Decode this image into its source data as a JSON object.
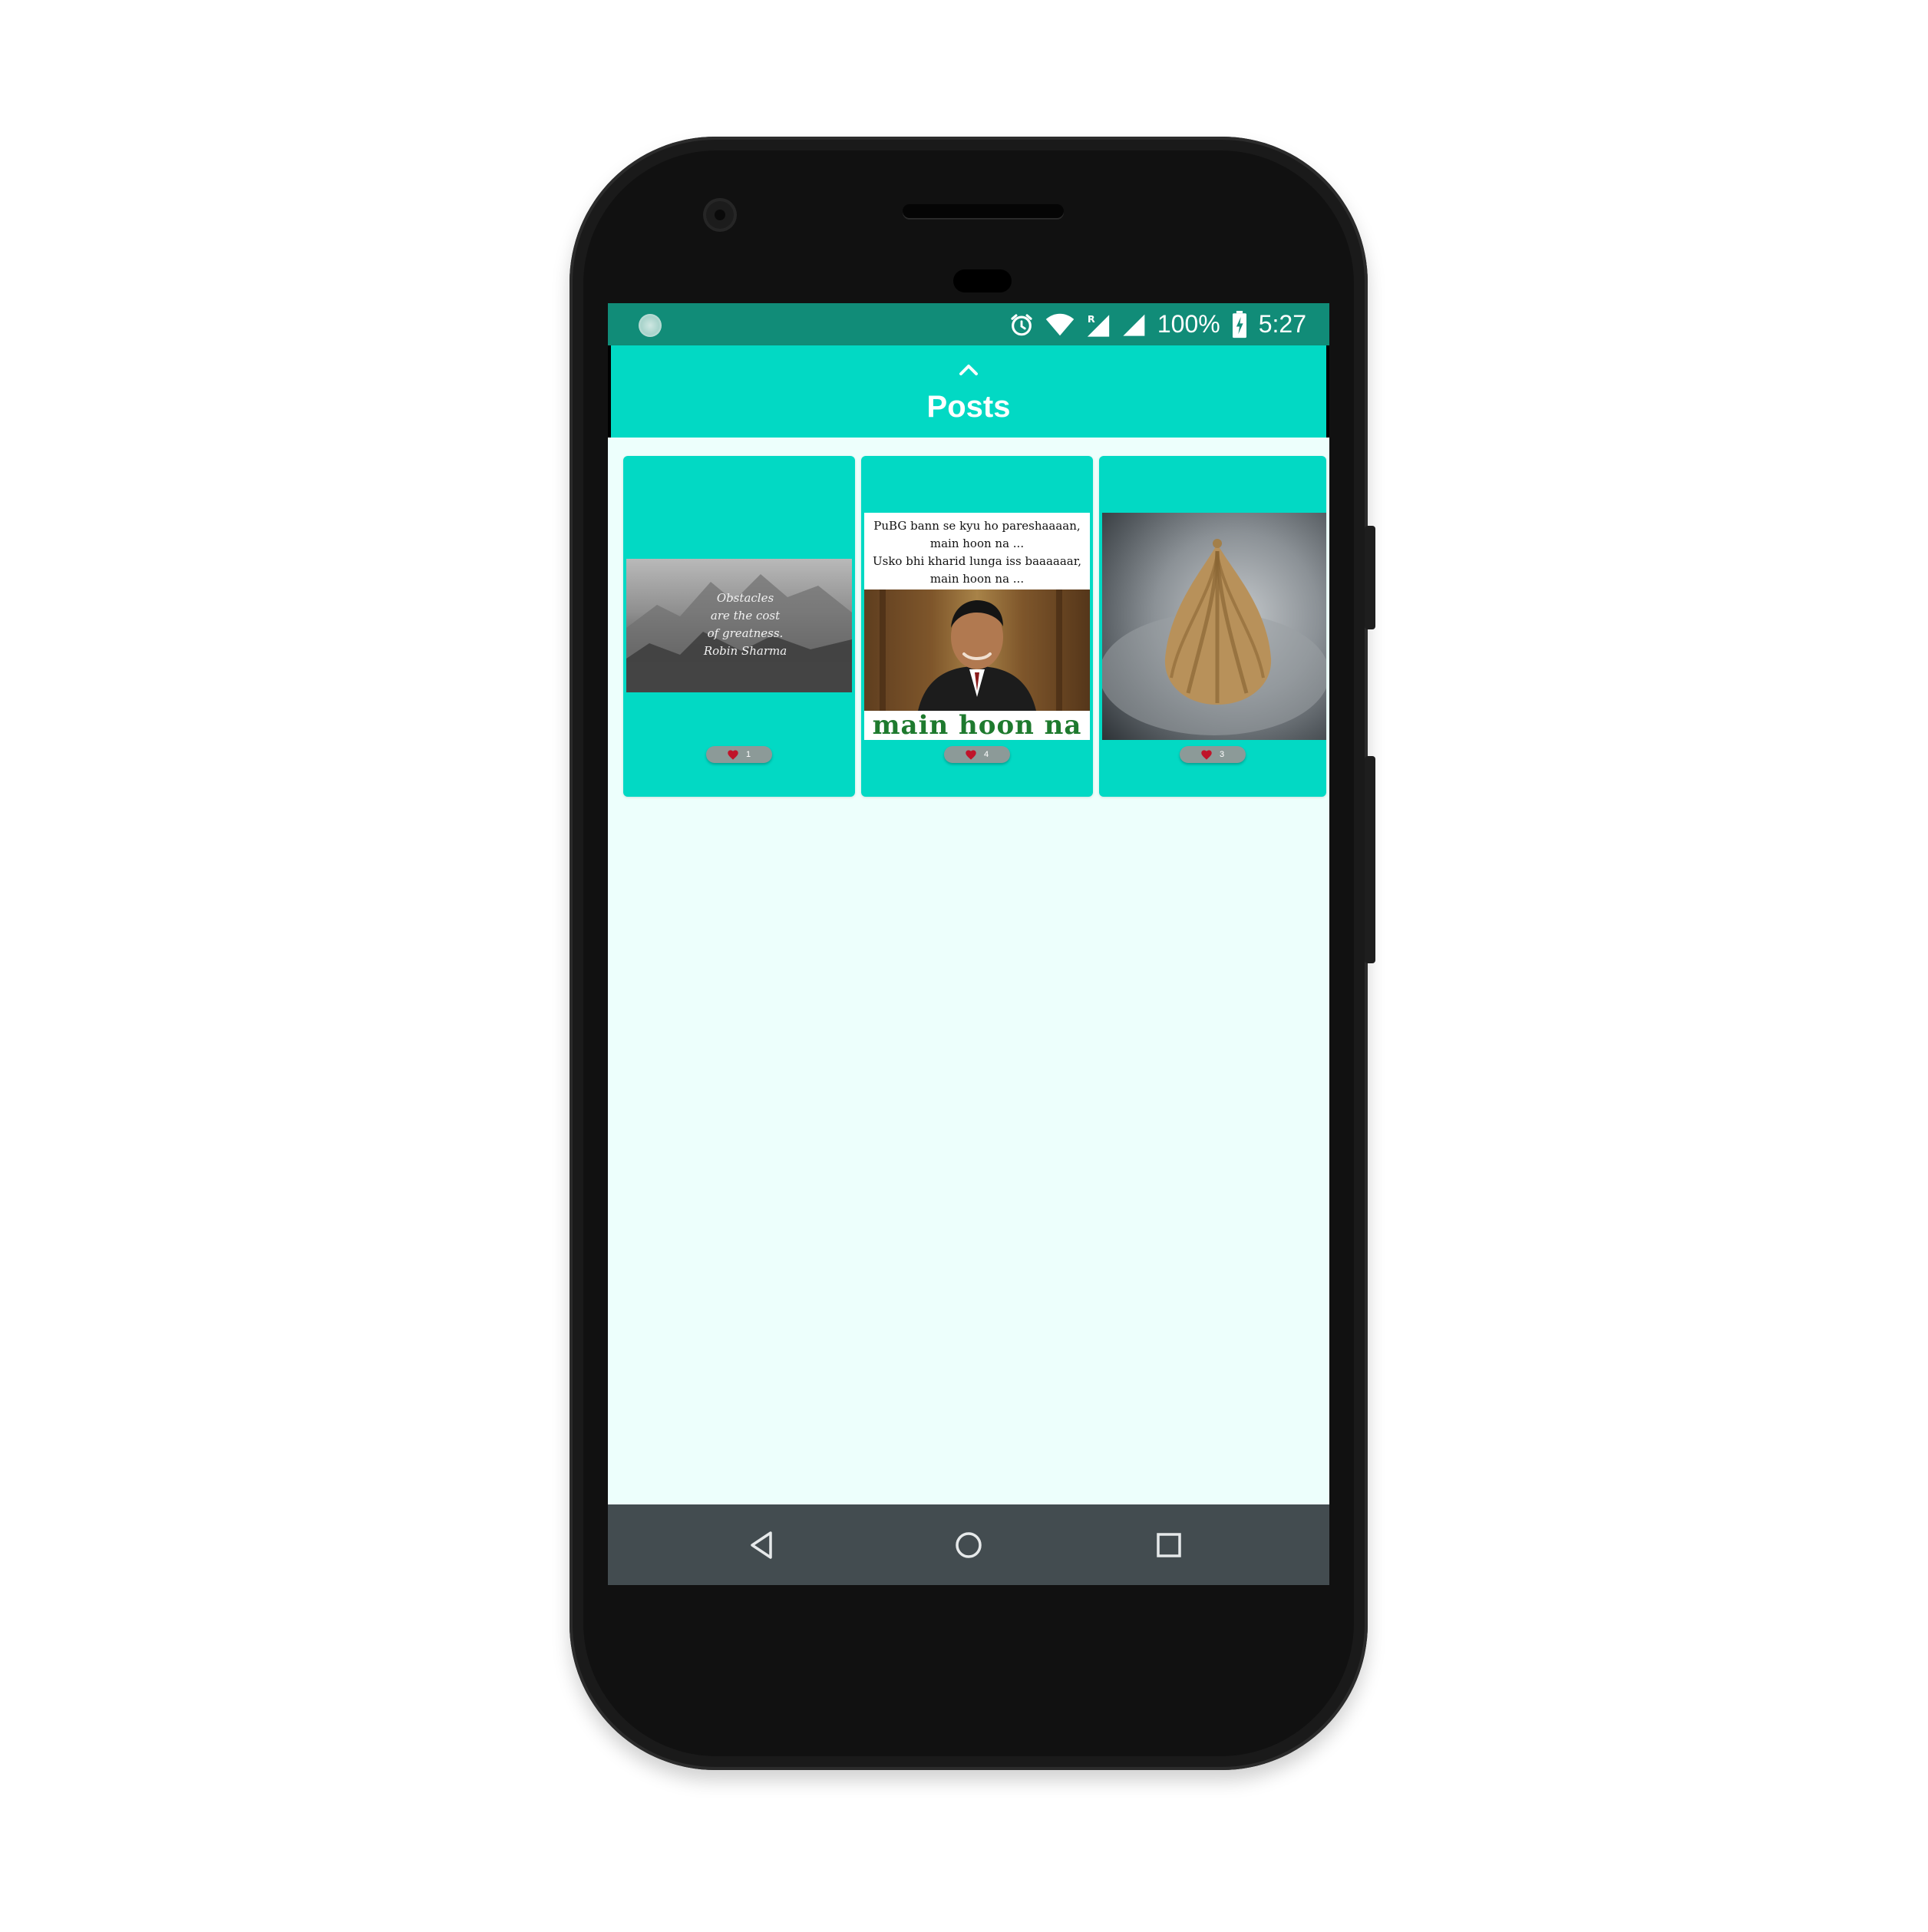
{
  "status_bar": {
    "battery_text": "100%",
    "time": "5:27",
    "icons": [
      "notification-icon",
      "alarm-icon",
      "wifi-icon",
      "roaming-signal-icon",
      "cell-signal-icon",
      "battery-charging-icon"
    ]
  },
  "app_bar": {
    "title": "Posts",
    "collapse_icon": "chevron-up-icon"
  },
  "posts": [
    {
      "quote_lines": [
        "Obstacles",
        "are the cost",
        "of greatness.",
        "Robin Sharma"
      ],
      "likes": "1"
    },
    {
      "caption_lines": [
        "PuBG bann se kyu ho pareshaaaan,",
        "main hoon na ...",
        "Usko bhi kharid lunga iss baaaaaar,",
        "main hoon na ..."
      ],
      "bottom_text": "main hoon na",
      "likes": "4"
    },
    {
      "likes": "3"
    }
  ],
  "nav_bar": {
    "icons": [
      "back-icon",
      "home-icon",
      "recent-apps-icon"
    ]
  },
  "colors": {
    "status_bar": "#118c78",
    "accent": "#02d9c4",
    "background": "#edfffc",
    "nav_bar": "#434c50",
    "like_heart": "#c0142a"
  }
}
